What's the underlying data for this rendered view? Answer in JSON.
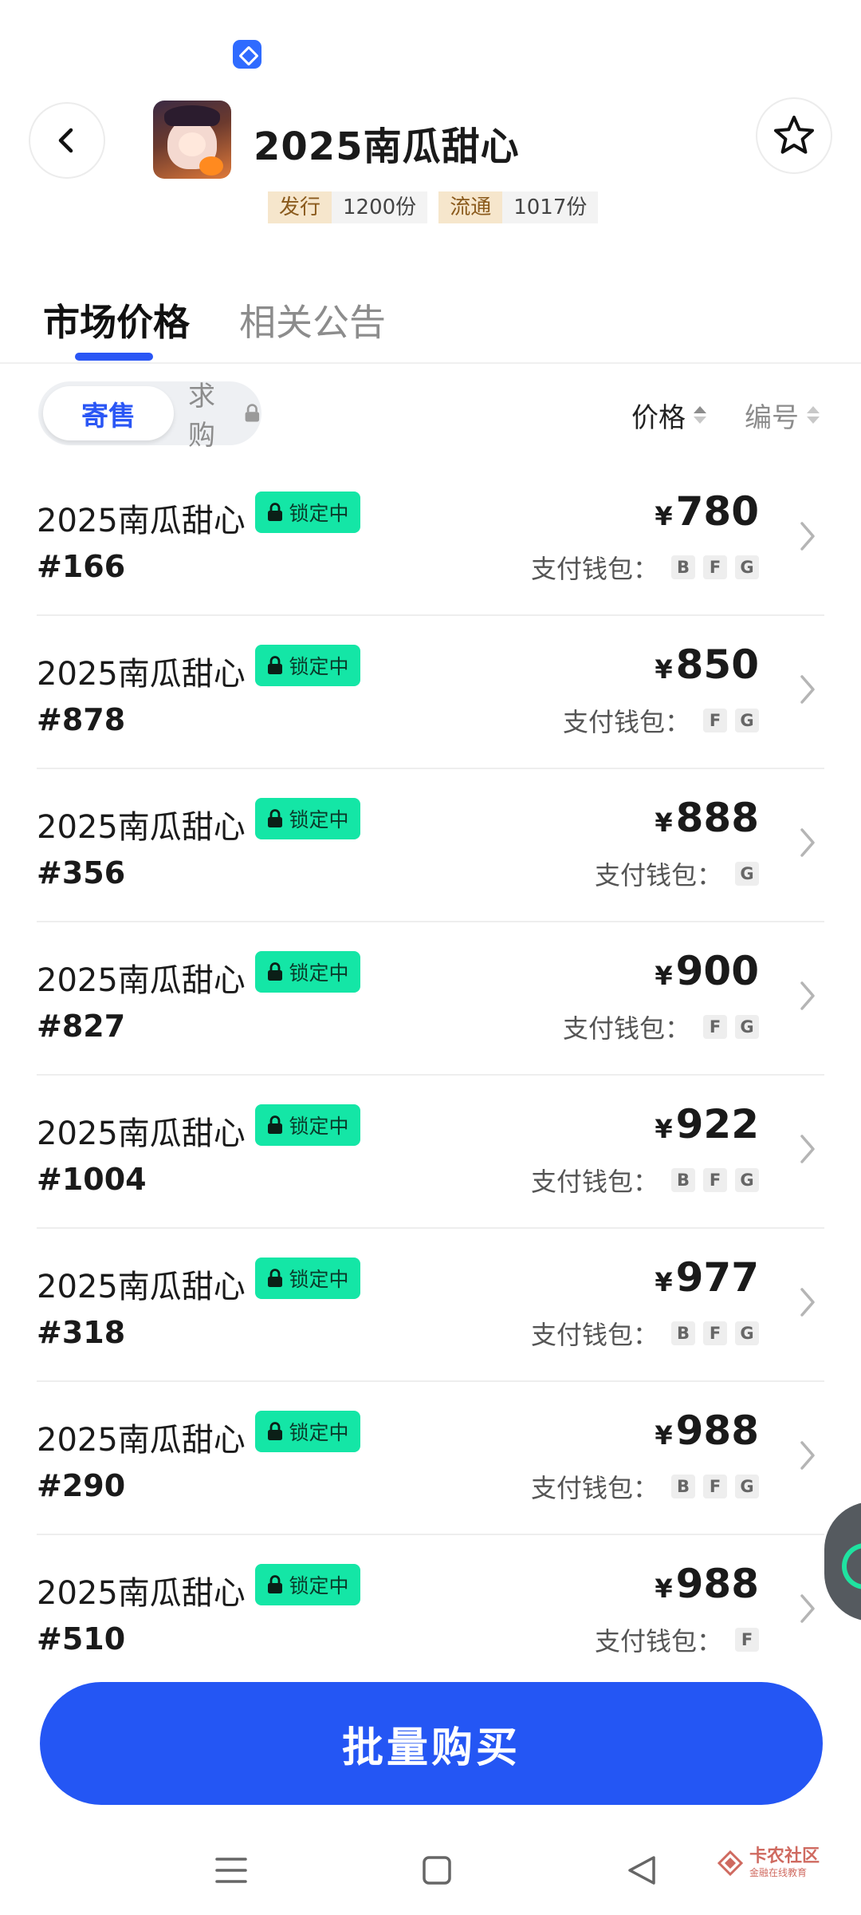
{
  "header": {
    "title": "2025南瓜甜心",
    "meta": [
      {
        "key": "发行",
        "value": "1200份"
      },
      {
        "key": "流通",
        "value": "1017份"
      }
    ]
  },
  "tabs": [
    {
      "label": "市场价格",
      "active": true
    },
    {
      "label": "相关公告",
      "active": false
    }
  ],
  "filter": {
    "segment_active": "寄售",
    "segment_locked": "求购",
    "sort_price": "价格",
    "sort_number": "编号"
  },
  "list_labels": {
    "badge": "锁定中",
    "wallet_label": "支付钱包：",
    "currency": "¥"
  },
  "listings": [
    {
      "name": "2025南瓜甜心",
      "number": "#166",
      "price": "780",
      "wallets": [
        "B",
        "F",
        "G"
      ]
    },
    {
      "name": "2025南瓜甜心",
      "number": "#878",
      "price": "850",
      "wallets": [
        "F",
        "G"
      ]
    },
    {
      "name": "2025南瓜甜心",
      "number": "#356",
      "price": "888",
      "wallets": [
        "G"
      ]
    },
    {
      "name": "2025南瓜甜心",
      "number": "#827",
      "price": "900",
      "wallets": [
        "F",
        "G"
      ]
    },
    {
      "name": "2025南瓜甜心",
      "number": "#1004",
      "price": "922",
      "wallets": [
        "B",
        "F",
        "G"
      ]
    },
    {
      "name": "2025南瓜甜心",
      "number": "#318",
      "price": "977",
      "wallets": [
        "B",
        "F",
        "G"
      ]
    },
    {
      "name": "2025南瓜甜心",
      "number": "#290",
      "price": "988",
      "wallets": [
        "B",
        "F",
        "G"
      ]
    },
    {
      "name": "2025南瓜甜心",
      "number": "#510",
      "price": "988",
      "wallets": [
        "F"
      ]
    }
  ],
  "actions": {
    "batch_buy": "批量购买"
  },
  "watermark": {
    "line1": "卡农社区",
    "line2": "金融在线教育"
  },
  "colors": {
    "accent": "#2456f4",
    "badge": "#14e6a6",
    "tag_bg": "#f6e6cc"
  },
  "icons": {
    "back": "chevron-left-icon",
    "favorite": "star-outline-icon",
    "lock": "lock-icon",
    "row_arrow": "chevron-right-icon"
  }
}
